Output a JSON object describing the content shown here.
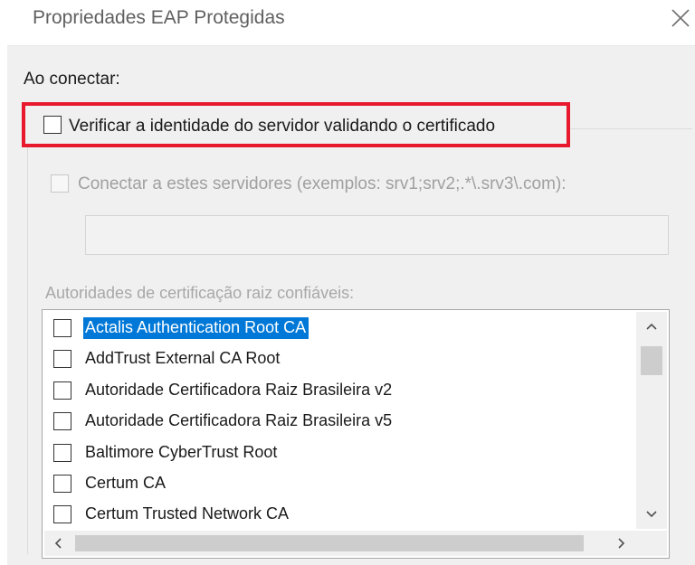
{
  "window": {
    "title": "Propriedades EAP Protegidas"
  },
  "connection": {
    "heading": "Ao conectar:",
    "verify_server_label": "Verificar a identidade do servidor validando o certificado",
    "verify_server_checked": false,
    "connect_servers_label": "Conectar a estes servidores (exemplos: srv1;srv2;.*\\.srv3\\.com):",
    "connect_servers_checked": false,
    "servers_value": ""
  },
  "trusted_ca": {
    "heading": "Autoridades de certificação raiz confiáveis:",
    "items": [
      {
        "label": "Actalis Authentication Root CA",
        "checked": false,
        "selected": true
      },
      {
        "label": "AddTrust External CA Root",
        "checked": false,
        "selected": false
      },
      {
        "label": "Autoridade Certificadora Raiz Brasileira v2",
        "checked": false,
        "selected": false
      },
      {
        "label": "Autoridade Certificadora Raiz Brasileira v5",
        "checked": false,
        "selected": false
      },
      {
        "label": "Baltimore CyberTrust Root",
        "checked": false,
        "selected": false
      },
      {
        "label": "Certum CA",
        "checked": false,
        "selected": false
      },
      {
        "label": "Certum Trusted Network CA",
        "checked": false,
        "selected": false
      }
    ],
    "scroll_up_icon": "chevron-up-icon",
    "scroll_down_icon": "chevron-down-icon",
    "scroll_left_icon": "chevron-left-icon",
    "scroll_right_icon": "chevron-right-icon"
  },
  "colors": {
    "highlight_border": "#e8192c",
    "selection": "#0078d7"
  }
}
